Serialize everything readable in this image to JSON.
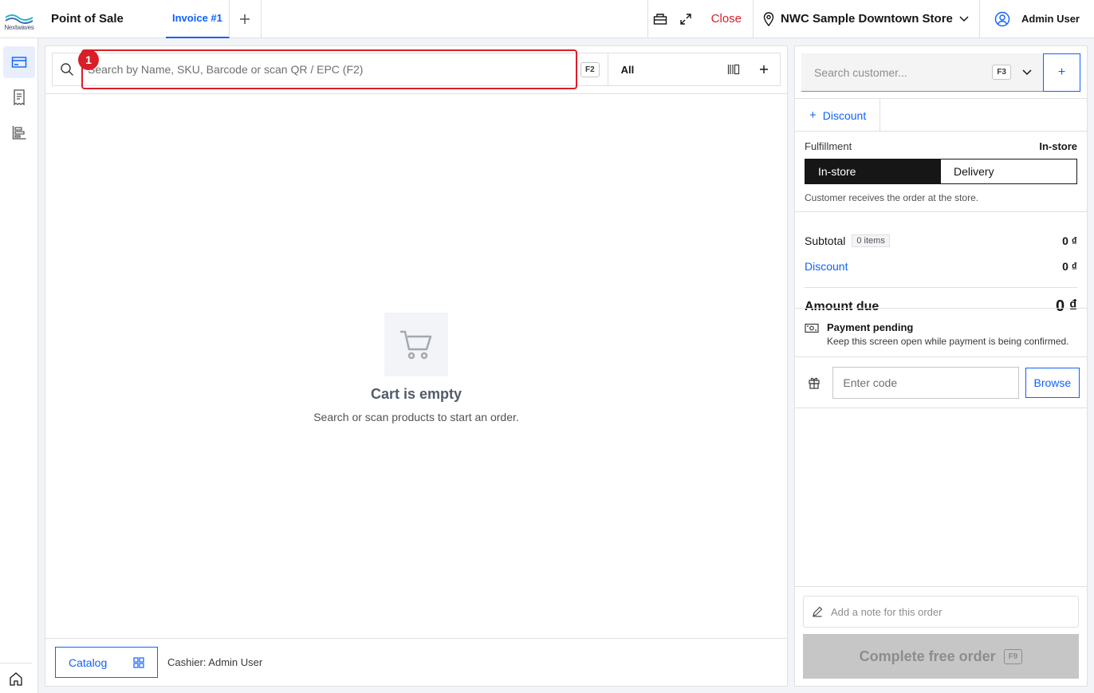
{
  "header": {
    "logo_text": "Nextwaves",
    "app_title": "Point of Sale",
    "tab_label": "Invoice #1",
    "add_tab_icon": "plus-icon",
    "close_label": "Close",
    "store_name": "NWC Sample Downtown Store",
    "user_name": "Admin User"
  },
  "sidebar": {
    "items": [
      {
        "icon": "card-icon",
        "active": true
      },
      {
        "icon": "receipt-icon",
        "active": false
      },
      {
        "icon": "chart-icon",
        "active": false
      }
    ],
    "home_icon": "home-icon"
  },
  "search": {
    "placeholder": "Search by Name, SKU, Barcode or scan QR / EPC (F2)",
    "shortcut": "F2",
    "annotation_number": "1",
    "category": "All"
  },
  "cart": {
    "empty_title": "Cart is empty",
    "empty_subtitle": "Search or scan products to start an order."
  },
  "footer": {
    "catalog_label": "Catalog",
    "cashier_text": "Cashier: Admin User"
  },
  "customer": {
    "placeholder": "Search customer...",
    "shortcut": "F3",
    "add_label": "+"
  },
  "discount_button": "Discount",
  "fulfillment": {
    "label": "Fulfillment",
    "value": "In-store",
    "options": [
      "In-store",
      "Delivery"
    ],
    "selected": "In-store",
    "note": "Customer receives the order at the store."
  },
  "totals": {
    "subtotal_label": "Subtotal",
    "items_count": "0 items",
    "subtotal_value": "0 ₫",
    "discount_label": "Discount",
    "discount_value": "0 ₫",
    "amount_due_label": "Amount due",
    "amount_due_value": "0 ₫"
  },
  "payment": {
    "title": "Payment pending",
    "subtitle": "Keep this screen open while payment is being confirmed."
  },
  "code": {
    "placeholder": "Enter code",
    "browse_label": "Browse"
  },
  "note_placeholder": "Add a note for this order",
  "complete": {
    "label": "Complete free order",
    "shortcut": "F9"
  },
  "colors": {
    "accent": "#0f62fe",
    "danger": "#da1e28",
    "dark": "#161616"
  }
}
